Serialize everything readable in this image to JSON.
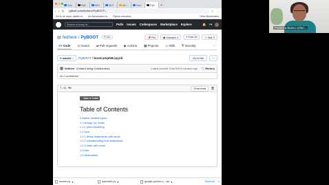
{
  "webcam": {
    "name": "Federica Bianco (she/..."
  },
  "tabs": [
    {
      "label": "Goo",
      "color": "#1a73e8"
    },
    {
      "label": "PyB",
      "color": "#24292f"
    },
    {
      "label": "MLF",
      "color": "#1a73e8"
    },
    {
      "label": "MLF",
      "color": "#1a73e8"
    },
    {
      "label": "An I",
      "color": "#f9ab00"
    },
    {
      "label": "Gen",
      "color": "#1a73e8"
    },
    {
      "label": "PyB",
      "color": "#24292f"
    }
  ],
  "address": {
    "url": "github.com/fedhere/PyBOOT/..."
  },
  "bookmarks": {
    "a": "Go to an input, hidden in...",
    "b": "An introduction to...",
    "c": "Python introduct...",
    "other": "Other Bookmarks"
  },
  "gh": {
    "search_placeholder": "Search or jump to...",
    "nav": [
      "Pulls",
      "Issues",
      "Codespaces",
      "Marketplace",
      "Explore"
    ]
  },
  "repo": {
    "owner": "fedhere",
    "name": "PyBOOT",
    "visibility": "Public",
    "pin": "Pin",
    "unwatch": "Unwatch",
    "unwatch_count": "1",
    "fork": "Fork",
    "fork_count": "10",
    "star": "Star",
    "star_count": "1",
    "tabs": [
      "Code",
      "Issues",
      "Pull requests",
      "Actions",
      "Projects",
      "Wiki",
      "Security"
    ]
  },
  "file": {
    "branch": "master",
    "path_repo": "PyBOOT",
    "path_file": "bootcampNB.ipynb",
    "goto": "Go to file",
    "more": "···"
  },
  "commit": {
    "author": "fedhere",
    "message": "Created using Colaboratory",
    "latest": "Latest commit 7eae7b8 6 minutes ago",
    "history": "History",
    "contributors": "At 1 contributor"
  },
  "viewer": {
    "size": "7.41 MB",
    "download": "Download",
    "colab_badge": "Open in Colab",
    "toc_title": "Table of Contents",
    "toc": [
      "1  Native variable types",
      "1.1  strings, int, floats",
      "1.1.1  print formatting",
      "1.2  bool",
      "1.2.1  if/else statements with bools",
      "1.2.2  concatenating bool statements",
      "1.2.3  math with bools",
      "1.3  lists",
      "1.4  dictionaries"
    ]
  },
  "downloads": {
    "items": [
      "wordle.py",
      "pywordle.py",
      "google-python-s....zip"
    ],
    "show_all": "Show All",
    "close": "×"
  }
}
